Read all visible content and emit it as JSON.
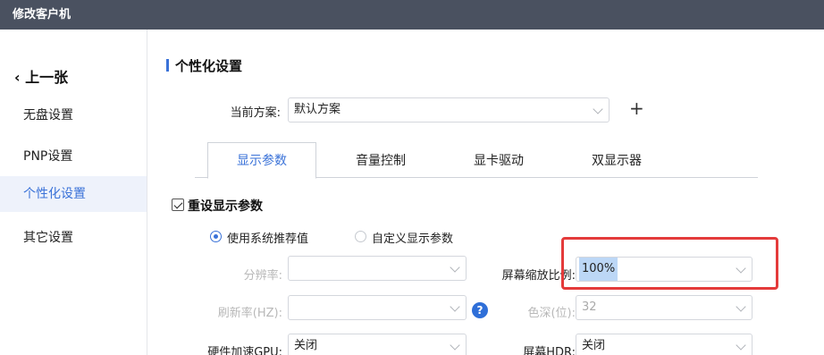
{
  "window": {
    "title": "修改客户机"
  },
  "sidebar": {
    "back_label": "‹ 上一张",
    "items": [
      {
        "label": "无盘设置"
      },
      {
        "label": "PNP设置"
      },
      {
        "label": "个性化设置"
      },
      {
        "label": "其它设置"
      }
    ],
    "active_index": 2
  },
  "main": {
    "section_title": "个性化设置",
    "scheme": {
      "label": "当前方案:",
      "value": "默认方案",
      "add_symbol": "+"
    },
    "tabs": [
      {
        "label": "显示参数"
      },
      {
        "label": "音量控制"
      },
      {
        "label": "显卡驱动"
      },
      {
        "label": "双显示器"
      }
    ],
    "active_tab": 0,
    "reset_display": {
      "label": "重设显示参数",
      "checked": true
    },
    "mode_options": [
      {
        "label": "使用系统推荐值",
        "selected": true
      },
      {
        "label": "自定义显示参数",
        "selected": false
      }
    ],
    "fields": {
      "resolution": {
        "label": "分辨率:",
        "value": ""
      },
      "scale": {
        "label": "屏幕缩放比例:",
        "value": "100%"
      },
      "refresh": {
        "label": "刷新率(HZ):",
        "value": ""
      },
      "help_symbol": "?",
      "color_depth": {
        "label": "色深(位):",
        "value": "32"
      },
      "gpu_accel": {
        "label": "硬件加速GPU:",
        "value": "关闭"
      },
      "hdr": {
        "label": "屏幕HDR:",
        "value": "关闭"
      }
    }
  },
  "colors": {
    "titlebar": "#4a5160",
    "accent": "#3a72d8",
    "highlight_box": "#e43b3b",
    "selection": "#bcd7f6"
  }
}
